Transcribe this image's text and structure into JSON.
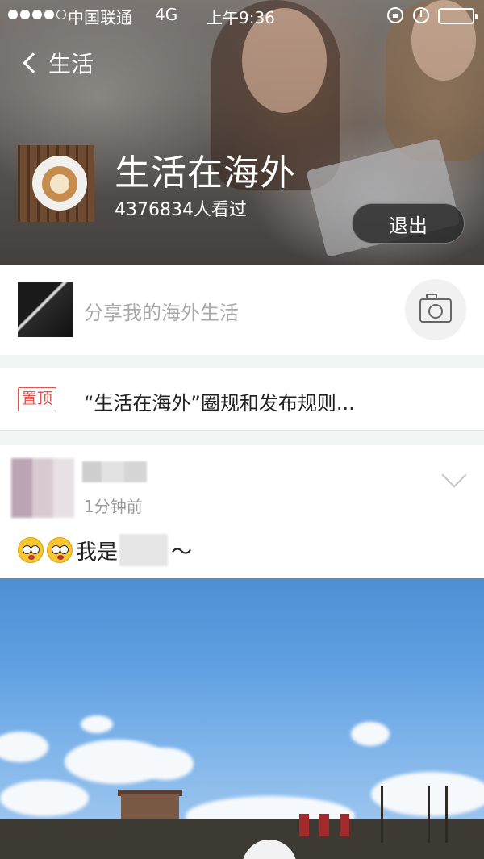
{
  "status_bar": {
    "carrier": "中国联通",
    "network": "4G",
    "time": "上午9:36",
    "signal_bars_filled": 4,
    "signal_bars_total": 5
  },
  "nav": {
    "back_label": "生活"
  },
  "circle": {
    "title": "生活在海外",
    "views": "4376834人看过",
    "exit_label": "退出"
  },
  "share": {
    "placeholder": "分享我的海外生活"
  },
  "pinned": {
    "badge": "置顶",
    "text": "“生活在海外”圈规和发布规则..."
  },
  "post": {
    "time": "1分钟前",
    "text_prefix": "我是",
    "text_suffix": "～"
  },
  "colors": {
    "accent_red": "#d9534f",
    "placeholder_gray": "#a9a9a9",
    "background": "#f3f4f4"
  }
}
